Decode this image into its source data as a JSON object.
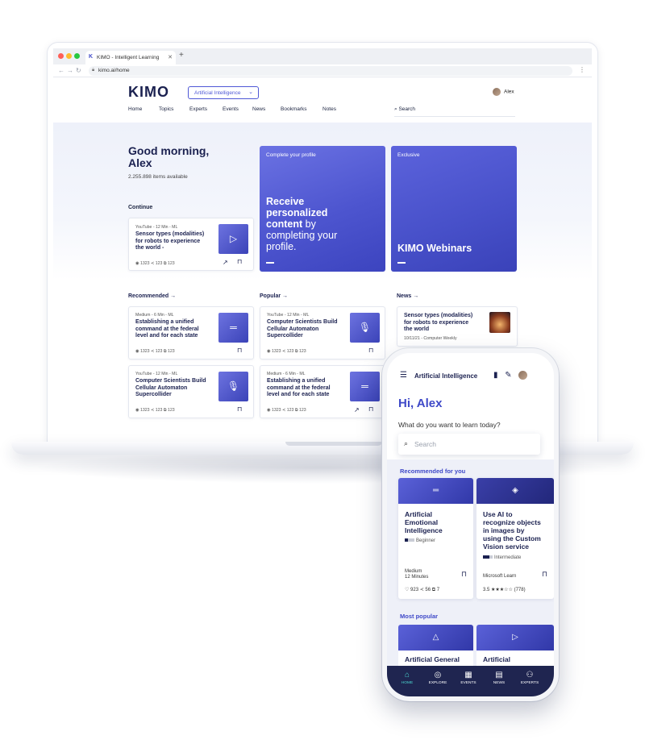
{
  "browser": {
    "tab_title": "KIMO - Intelligent Learning",
    "tab_icon_letter": "K",
    "url": "kimo.ai/home"
  },
  "site": {
    "logo": "KIMO",
    "topic_selector": "Artificial Intelligence",
    "user_name": "Alex",
    "nav": [
      "Home",
      "Topics",
      "Experts",
      "Events",
      "News",
      "Bookmarks",
      "Notes"
    ],
    "search_label": "Search"
  },
  "hero": {
    "greeting_line1": "Good morning,",
    "greeting_line2": "Alex",
    "items_available": "2.255.898 items available",
    "continue_label": "Continue",
    "continue_card": {
      "meta": "YouTube - 12 Min - ML",
      "title": [
        "Sensor types (modalities)",
        "for robots to experience",
        "the world -"
      ],
      "stats": "◉ 1323   ≺ 123   ⧉ 123"
    },
    "promo_profile": {
      "label": "Complete your profile",
      "bold": [
        "Receive",
        "personalized",
        "content"
      ],
      "rest_inline": " by",
      "rest": [
        "completing your",
        "profile."
      ]
    },
    "promo_exclusive": {
      "label": "Exclusive",
      "title": "KIMO Webinars"
    }
  },
  "sections": {
    "recommended": "Recommended",
    "popular": "Popular",
    "news": "News"
  },
  "cards": {
    "rec1": {
      "meta": "Medium - 6 Min - ML",
      "title": [
        "Establishing a unified",
        "command at the federal",
        "level and for each state"
      ],
      "stats": "◉ 1323   ≺ 123   ⧉ 123"
    },
    "rec2": {
      "meta": "YouTube - 12 Min - ML",
      "title": [
        "Computer Scientists Build",
        "Cellular Automaton",
        "Supercollider"
      ],
      "stats": "◉ 1323   ≺ 123   ⧉ 123"
    },
    "pop1": {
      "meta": "YouTube - 12 Min - ML",
      "title": [
        "Computer Scientists Build",
        "Cellular Automaton",
        "Supercollider"
      ],
      "stats": "◉ 1323   ≺ 123   ⧉ 123"
    },
    "pop2": {
      "meta": "Medium - 6 Min - ML",
      "title": [
        "Establishing a unified",
        "command at the federal",
        "level and for each state"
      ],
      "stats": "◉ 1323   ≺ 123   ⧉ 123"
    },
    "news1": {
      "title": [
        "Sensor types (modalities)",
        "for robots to experience",
        "the world"
      ],
      "meta": "10/11/21 - Computer Weekly"
    }
  },
  "phone": {
    "header_title": "Artificial Intelligence",
    "greeting": "Hi, Alex",
    "question": "What do you want to learn today?",
    "search_placeholder": "Search",
    "recommended_label": "Recommended for you",
    "card1": {
      "title": [
        "Artificial",
        "Emotional",
        "Intelligence"
      ],
      "level": "Beginner",
      "source": "Medium",
      "duration": "12 Minutes",
      "stats": "♡ 923   ≺ 56   ⧉ 7"
    },
    "card2": {
      "title": [
        "Use AI to",
        "recognize objects",
        "in images by",
        "using the Custom",
        "Vision service"
      ],
      "level": "Intermediate",
      "source": "Microsoft Learn",
      "rating": "3.5 ★★★☆☆ (778)"
    },
    "popular_label": "Most popular",
    "pop_card1": "Artificial General",
    "pop_card2": "Artificial",
    "nav": [
      "HOME",
      "EXPLORE",
      "EVENTS",
      "NEWS",
      "EXPERTS"
    ]
  },
  "colors": {
    "accent": "#3f49c8",
    "navy": "#1b2150",
    "promo": "#5a61d8",
    "nav_active": "#4bd6d0"
  },
  "icons": [
    "close-icon",
    "plus-icon",
    "back-icon",
    "forward-icon",
    "reload-icon",
    "lock-icon",
    "kebab-icon",
    "chevron-down-icon",
    "search-icon",
    "arrow-right-icon",
    "play-icon",
    "mic-icon",
    "bookmark-icon",
    "share-icon",
    "menu-icon",
    "edit-icon",
    "home-icon",
    "compass-icon",
    "calendar-icon",
    "news-icon",
    "experts-icon"
  ]
}
